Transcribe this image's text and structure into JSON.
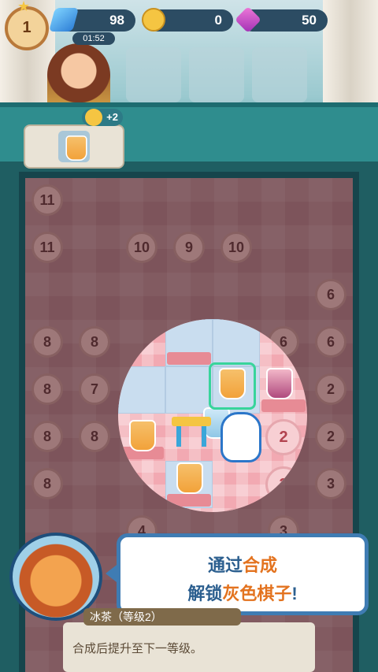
{
  "hud": {
    "level": "1",
    "timer": "01:52",
    "energy": "98",
    "coins": "0",
    "gems": "50"
  },
  "order": {
    "reward": "+2"
  },
  "board": {
    "chips": [
      {
        "r": 0,
        "c": 0,
        "v": "11"
      },
      {
        "r": 1,
        "c": 0,
        "v": "11"
      },
      {
        "r": 1,
        "c": 2,
        "v": "10"
      },
      {
        "r": 1,
        "c": 3,
        "v": "9"
      },
      {
        "r": 1,
        "c": 4,
        "v": "10"
      },
      {
        "r": 2,
        "c": 6,
        "v": "6"
      },
      {
        "r": 3,
        "c": 0,
        "v": "8"
      },
      {
        "r": 3,
        "c": 1,
        "v": "8"
      },
      {
        "r": 3,
        "c": 5,
        "v": "6"
      },
      {
        "r": 3,
        "c": 6,
        "v": "6"
      },
      {
        "r": 4,
        "c": 0,
        "v": "8"
      },
      {
        "r": 4,
        "c": 1,
        "v": "7"
      },
      {
        "r": 4,
        "c": 6,
        "v": "2"
      },
      {
        "r": 5,
        "c": 0,
        "v": "8"
      },
      {
        "r": 5,
        "c": 1,
        "v": "8"
      },
      {
        "r": 5,
        "c": 6,
        "v": "2"
      },
      {
        "r": 6,
        "c": 0,
        "v": "8"
      },
      {
        "r": 6,
        "c": 6,
        "v": "3"
      },
      {
        "r": 7,
        "c": 2,
        "v": "4"
      },
      {
        "r": 7,
        "c": 5,
        "v": "3"
      }
    ],
    "spot_chips": [
      {
        "v": "2"
      },
      {
        "v": "3"
      },
      {
        "v": "3"
      }
    ]
  },
  "tutorial": {
    "line1_a": "通过",
    "line1_b": "合成",
    "line2_a": "解锁",
    "line2_b": "灰色棋子",
    "line2_c": "!"
  },
  "info": {
    "title": "冰茶（等级2）",
    "desc": "合成后提升至下一等级。"
  }
}
